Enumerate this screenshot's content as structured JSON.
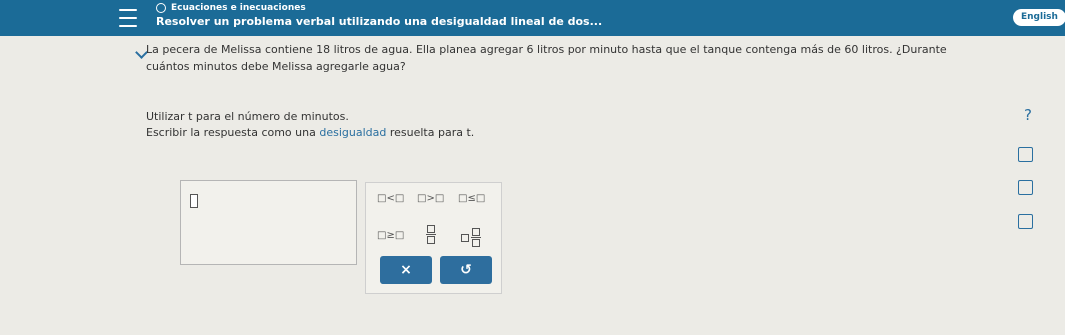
{
  "header": {
    "topic": "Ecuaciones e inecuaciones",
    "title": "Resolver un problema verbal utilizando una desigualdad lineal de dos...",
    "language_button": "English"
  },
  "problem": {
    "text": "La pecera de Melissa contiene 18 litros de agua. Ella planea agregar 6 litros por minuto hasta que el tanque contenga más de 60 litros. ¿Durante cuántos minutos debe Melissa agregarle agua?",
    "instruction_1": "Utilizar t para el número de minutos.",
    "instruction_2_prefix": "Escribir la respuesta como una ",
    "instruction_2_link": "desigualdad",
    "instruction_2_suffix": " resuelta para t."
  },
  "keypad": {
    "less_than": "□<□",
    "greater_than": "□>□",
    "less_equal": "□≤□",
    "greater_equal": "□≥□",
    "clear": "×",
    "undo": "↺"
  },
  "sidebar": {
    "help": "?"
  },
  "colors": {
    "header_blue": "#1b6b97",
    "button_blue": "#2e6e9e",
    "link_blue": "#2a6fa0"
  }
}
